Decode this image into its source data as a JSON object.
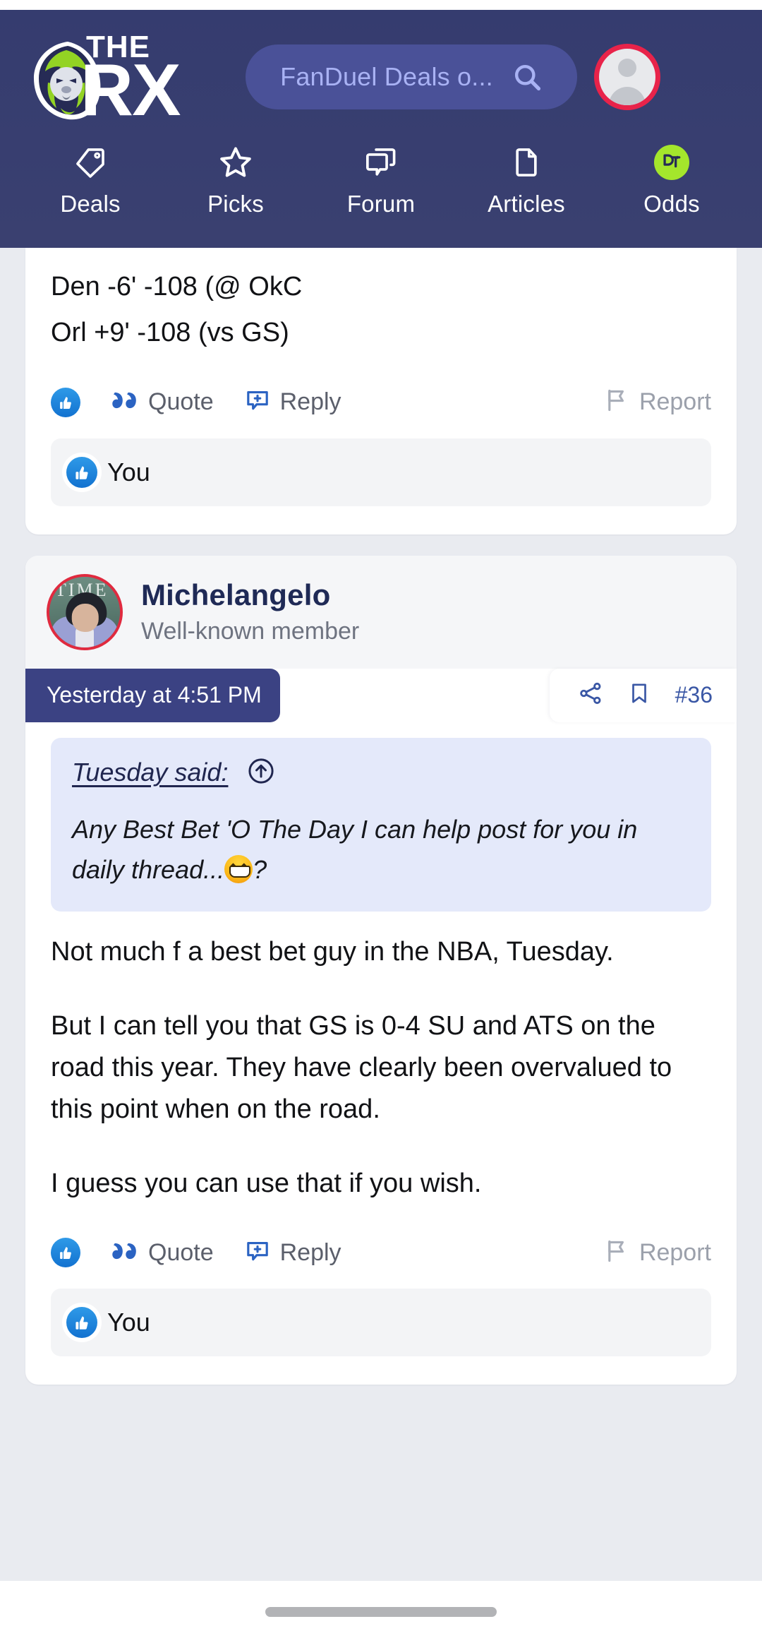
{
  "header": {
    "logo": {
      "line1": "THE",
      "line2": "RX",
      "icon": "lion-mascot-logo"
    },
    "search": {
      "value": "FanDuel Deals o...",
      "placeholder": "Search",
      "icon": "search-icon"
    },
    "account": {
      "icon": "user-avatar-icon"
    },
    "nav": [
      {
        "label": "Deals",
        "icon": "tag-icon"
      },
      {
        "label": "Picks",
        "icon": "star-icon"
      },
      {
        "label": "Forum",
        "icon": "chat-bubbles-icon"
      },
      {
        "label": "Articles",
        "icon": "document-icon"
      },
      {
        "label": "Odds",
        "icon": "odds-badge-icon"
      }
    ]
  },
  "colors": {
    "header_bg": "#343a6b",
    "accent_blue": "#3a57a5",
    "timestamp_bg": "#3b4283",
    "quote_bg": "#e4e9fa",
    "like_blue": "#1272d0",
    "odds_green": "#a4e62c",
    "avatar_ring_red": "#e8234a",
    "page_bg": "#e9ebf0"
  },
  "posts": [
    {
      "id": "post-partial",
      "body_lines": [
        "Den -6' -108 (@ OkC",
        "Orl +9' -108 (vs GS)"
      ],
      "actions": {
        "like_icon": "thumbs-up-icon",
        "quote_label": "Quote",
        "quote_icon": "quote-marks-icon",
        "reply_label": "Reply",
        "reply_icon": "reply-bubble-icon",
        "report_label": "Report",
        "report_icon": "flag-icon"
      },
      "reactions": {
        "icon": "thumbs-up-icon",
        "label": "You"
      }
    },
    {
      "id": "post-36",
      "author": {
        "name": "Michelangelo",
        "title": "Well-known member",
        "avatar_icon": "user-photo-avatar"
      },
      "meta": {
        "timestamp": "Yesterday at 4:51 PM",
        "share_icon": "share-icon",
        "bookmark_icon": "bookmark-icon",
        "post_number": "#36"
      },
      "quote": {
        "author_label": "Tuesday said:",
        "jump_icon": "arrow-up-circle-icon",
        "text_before_emoji": "Any Best Bet 'O The Day I can help post for you in daily thread...",
        "emoji": "grinning-face-emoji",
        "text_after_emoji": "?"
      },
      "body_paragraphs": [
        "Not much f a best bet guy in the NBA, Tuesday.",
        "But I can tell you that GS is 0-4 SU and ATS on the road this year. They have clearly been overvalued to this point when on the road.",
        "I guess you can use that if you wish."
      ],
      "actions": {
        "like_icon": "thumbs-up-icon",
        "quote_label": "Quote",
        "quote_icon": "quote-marks-icon",
        "reply_label": "Reply",
        "reply_icon": "reply-bubble-icon",
        "report_label": "Report",
        "report_icon": "flag-icon"
      },
      "reactions": {
        "icon": "thumbs-up-icon",
        "label": "You"
      }
    }
  ]
}
